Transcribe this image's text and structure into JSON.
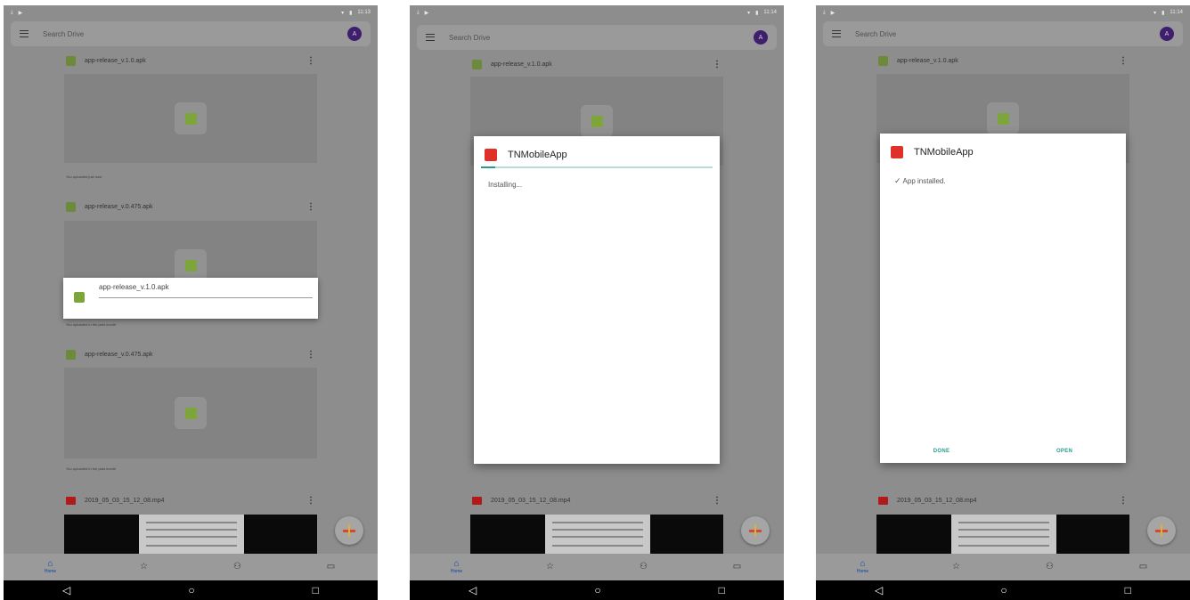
{
  "status_bar": {
    "left_icons": [
      "download-icon",
      "play-icon"
    ],
    "right_icons": [
      "battery-icon",
      "signal-icon"
    ],
    "times": [
      "11:13",
      "11:14",
      "11:14"
    ]
  },
  "search": {
    "placeholder": "Search Drive",
    "avatar_letter": "A"
  },
  "files": [
    {
      "name": "app-release_v.1.0.apk",
      "meta": "You uploaded just now"
    },
    {
      "name": "app-release_v.0.475.apk",
      "meta": "You uploaded in the past month"
    },
    {
      "name": "app-release_v.0.475.apk",
      "meta": "You uploaded in the past month"
    },
    {
      "name": "2019_05_03_15_12_08.mp4",
      "meta": ""
    }
  ],
  "download_popup": {
    "file_name": "app-release_v.1.0.apk"
  },
  "install_dialog": {
    "app_name": "TNMobileApp",
    "installing_text": "Installing...",
    "installing_progress": 0.06,
    "installed_text": "App installed.",
    "done_label": "DONE",
    "open_label": "OPEN"
  },
  "bottom_nav": {
    "home_label": "Home",
    "items": [
      "home-icon",
      "star-icon",
      "shared-icon",
      "folder-icon"
    ]
  },
  "system_nav": [
    "back-icon",
    "home-circle-icon",
    "recents-icon"
  ]
}
